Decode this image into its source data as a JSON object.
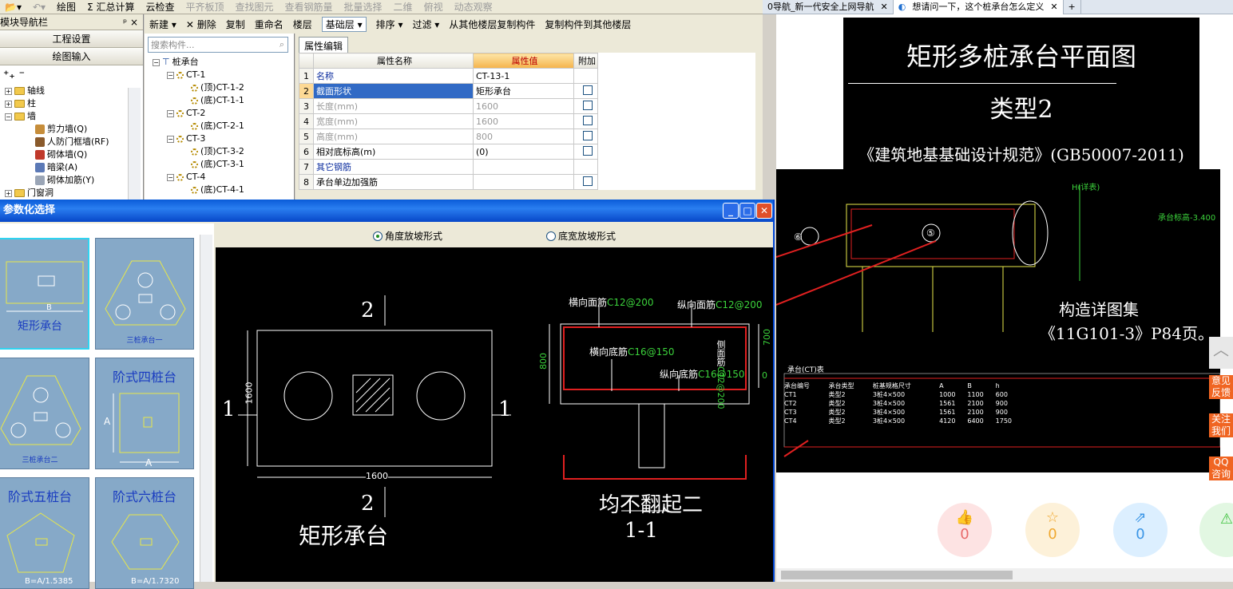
{
  "toolbar1": {
    "items": [
      "绘图",
      "Σ 汇总计算",
      "云检查",
      "平齐板顶",
      "查找图元",
      "查看钢筋量",
      "批量选择",
      "二维",
      "俯视",
      "动态观察"
    ]
  },
  "nav": {
    "title": "模块导航栏",
    "pin": "ᵖ ×",
    "btn1": "工程设置",
    "btn2": "绘图输入",
    "tools": "⁺₊ ⁻",
    "items": [
      "轴线",
      "柱",
      "墙",
      "剪力墙(Q)",
      "人防门框墙(RF)",
      "砌体墙(Q)",
      "暗梁(A)",
      "砌体加筋(Y)",
      "门窗洞"
    ]
  },
  "comp": {
    "toolbar": [
      "新建 ▾",
      "✕ 删除",
      "复制",
      "重命名",
      "楼层",
      "基础层",
      "▾"
    ],
    "search_placeholder": "搜索构件...",
    "tree": [
      "桩承台",
      "CT-1",
      "(顶)CT-1-2",
      "(底)CT-1-1",
      "CT-2",
      "(底)CT-2-1",
      "CT-3",
      "(顶)CT-3-2",
      "(底)CT-3-1",
      "CT-4",
      "(底)CT-4-1"
    ]
  },
  "prop": {
    "toolbar": [
      "排序 ▾",
      "过滤 ▾",
      "从其他楼层复制构件",
      "复制构件到其他楼层"
    ],
    "tab": "属性编辑",
    "headers": [
      "属性名称",
      "属性值",
      "附加"
    ],
    "rows": [
      [
        "1",
        "名称",
        "CT-13-1"
      ],
      [
        "2",
        "截面形状",
        "矩形承台"
      ],
      [
        "3",
        "长度(mm)",
        "1600"
      ],
      [
        "4",
        "宽度(mm)",
        "1600"
      ],
      [
        "5",
        "高度(mm)",
        "800"
      ],
      [
        "6",
        "相对底标高(m)",
        "(0)"
      ],
      [
        "7",
        "其它钢筋",
        ""
      ],
      [
        "8",
        "承台单边加强筋",
        ""
      ]
    ]
  },
  "dialog": {
    "title": "参数化选择",
    "side_label": "形",
    "radio1": "角度放坡形式",
    "radio2": "底宽放坡形式",
    "thumbs": [
      "矩形承台",
      "三桩承台一",
      "三桩承台二",
      "阶式四桩台",
      "阶式五桩台",
      "阶式六桩台"
    ],
    "thumb_small": [
      "B",
      "A",
      "A",
      "B=A/1.5385",
      "B=A/1.7320"
    ]
  },
  "cad": {
    "plan_top": "2",
    "plan_bottom": "2",
    "plan_left": "1",
    "plan_right": "1",
    "dim_w": "1600",
    "dim_h": "1600",
    "plan_title": "矩形承台",
    "sec_label1": "横向面筋",
    "sec_val1": "C12@200",
    "sec_label2": "纵向面筋",
    "sec_val2": "C12@200",
    "sec_label3": "横向底筋",
    "sec_val3": "C16@150",
    "sec_label4": "纵向底筋",
    "sec_val4": "C16@150",
    "side_bar": "侧面筋",
    "side_val": "C12@200",
    "dim_800": "800",
    "dim_700": "700",
    "dim_0": "0",
    "sec_note": "均不翻起二",
    "sec_title": "1-1"
  },
  "browser": {
    "tab1": "0导航_新一代安全上网导航",
    "tab2": "想请问一下，这个桩承台怎么定义",
    "close": "✕",
    "new": "+",
    "img_title": "矩形多桩承台平面图",
    "img_sub": "类型2",
    "img_ref": "《建筑地基基础设计规范》(GB50007-2011)",
    "img_note1": "构造详图集",
    "img_note2": "《11G101-3》P84页。",
    "img_h": "H(详表)",
    "img_elev": "承台标高-3.400",
    "table_title": "承台(CT)表",
    "table_headers": [
      "承台编号",
      "承台类型",
      "桩基规格尺寸",
      "A",
      "B",
      "h"
    ],
    "table_rows": [
      [
        "CT1",
        "类型2",
        "3桩4×500",
        "1000",
        "1100",
        "600"
      ],
      [
        "CT2",
        "类型2",
        "3桩4×500",
        "1561",
        "2100",
        "900"
      ],
      [
        "CT3",
        "类型2",
        "3桩4×500",
        "1561",
        "2100",
        "900"
      ],
      [
        "CT4",
        "类型2",
        "3桩4×500",
        "4120",
        "6400",
        "1750"
      ]
    ],
    "side": [
      "意见反馈",
      "关注我们",
      "QQ咨询"
    ],
    "counts": [
      "0",
      "0",
      "0"
    ]
  }
}
